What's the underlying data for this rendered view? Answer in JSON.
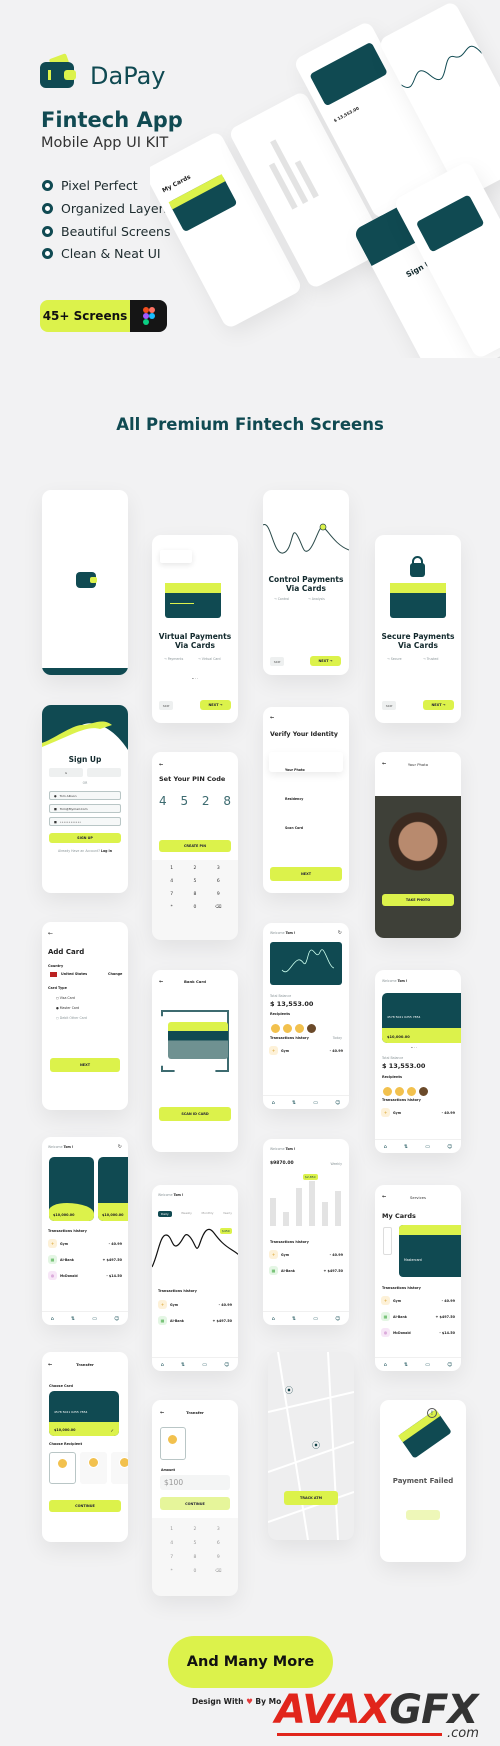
{
  "header": {
    "brand": "DaPay",
    "title": "Fintech App",
    "subtitle": "Mobile App UI KIT",
    "features": [
      "Pixel Perfect",
      "Organized Layers",
      "Beautiful Screens",
      "Clean & Neat UI"
    ],
    "badge": "45+ Screens",
    "figma_icon": "figma-icon"
  },
  "section_title": "All Premium Fintech Screens",
  "colors": {
    "primary": "#104a52",
    "accent": "#dcf24b",
    "background": "#f2f2f3"
  },
  "onboarding": [
    {
      "title": "Virtual Payments Via Cards",
      "tags": [
        "Payments",
        "Virtual Card"
      ]
    },
    {
      "title": "Control Payments Via Cards",
      "tags": [
        "Control",
        "Analysis"
      ]
    },
    {
      "title": "Secure Payments Via Cards",
      "tags": [
        "Secure",
        "Trusted"
      ]
    }
  ],
  "common": {
    "skip": "SKIP",
    "next": "NEXT",
    "continue": "CONTINUE",
    "recipients": "Recipients",
    "transactions": "Transactions history",
    "filter": "Today",
    "welcome": "Welcome",
    "name": "Tom !"
  },
  "signup": {
    "title": "Sign Up",
    "or": "OR",
    "name": "Tom Allison",
    "email": "Tom@Mymail.Com",
    "password": "••••••••••••",
    "button": "SIGN UP",
    "footer": "Already Have an Account?",
    "login": "Log In"
  },
  "pin": {
    "title": "Set Your PIN Code",
    "digits": [
      "4",
      "5",
      "2",
      "8"
    ],
    "button": "CREATE PIN",
    "keys": [
      "1",
      "2",
      "3",
      "4",
      "5",
      "6",
      "7",
      "8",
      "9",
      "*",
      "0",
      "⌫"
    ]
  },
  "verify": {
    "title": "Verify Your Identity",
    "items": [
      "Your Photo",
      "Residency",
      "Scan Card"
    ],
    "button": "NEXT"
  },
  "photo": {
    "title": "Your Photo",
    "button": "TAKE PHOTO"
  },
  "addcard": {
    "title": "Add Card",
    "country_label": "Country",
    "country": "United States",
    "change": "Change",
    "type_label": "Card Type",
    "options": [
      "Visa Card",
      "Master Card",
      "Debit Other Card"
    ],
    "button": "NEXT"
  },
  "bankcard": {
    "title": "Bank Card",
    "button": "SCAN ID CARD"
  },
  "home": {
    "balance_label": "Total Balance",
    "balance": "$ 13,553.00",
    "card_number": "4578 5021 0255 7854",
    "card_amount": "$10,000.00"
  },
  "txns": [
    {
      "name": "Gym",
      "type": "Payment",
      "amount": "- 40.99"
    },
    {
      "name": "Al-Bank",
      "type": "Deposit",
      "amount": "+ $497.50"
    },
    {
      "name": "McDonald",
      "type": "Payment",
      "amount": "- $14.50"
    }
  ],
  "chart_screen": {
    "tabs": [
      "Daily",
      "Weekly",
      "Monthly",
      "Yearly"
    ],
    "tooltip": "$450"
  },
  "bars_screen": {
    "balance": "$9870.00",
    "filter": "Weekly",
    "badge": "$2,850"
  },
  "services": {
    "title": "Services",
    "cards": "My Cards",
    "card_name": "Mastercard"
  },
  "transfer": {
    "title": "Transfer",
    "choose_card": "Choose Card",
    "choose_recipient": "Choose Recipient",
    "amount_label": "Amount",
    "amount": "$100"
  },
  "map": {
    "button": "TRACK ATM"
  },
  "failed": {
    "title": "Payment Failed"
  },
  "cta": "And Many More",
  "footer": {
    "prefix": "Design With",
    "suffix": "By Mo"
  },
  "watermark": {
    "text": "AVAXGFX",
    "domain": ".com"
  }
}
